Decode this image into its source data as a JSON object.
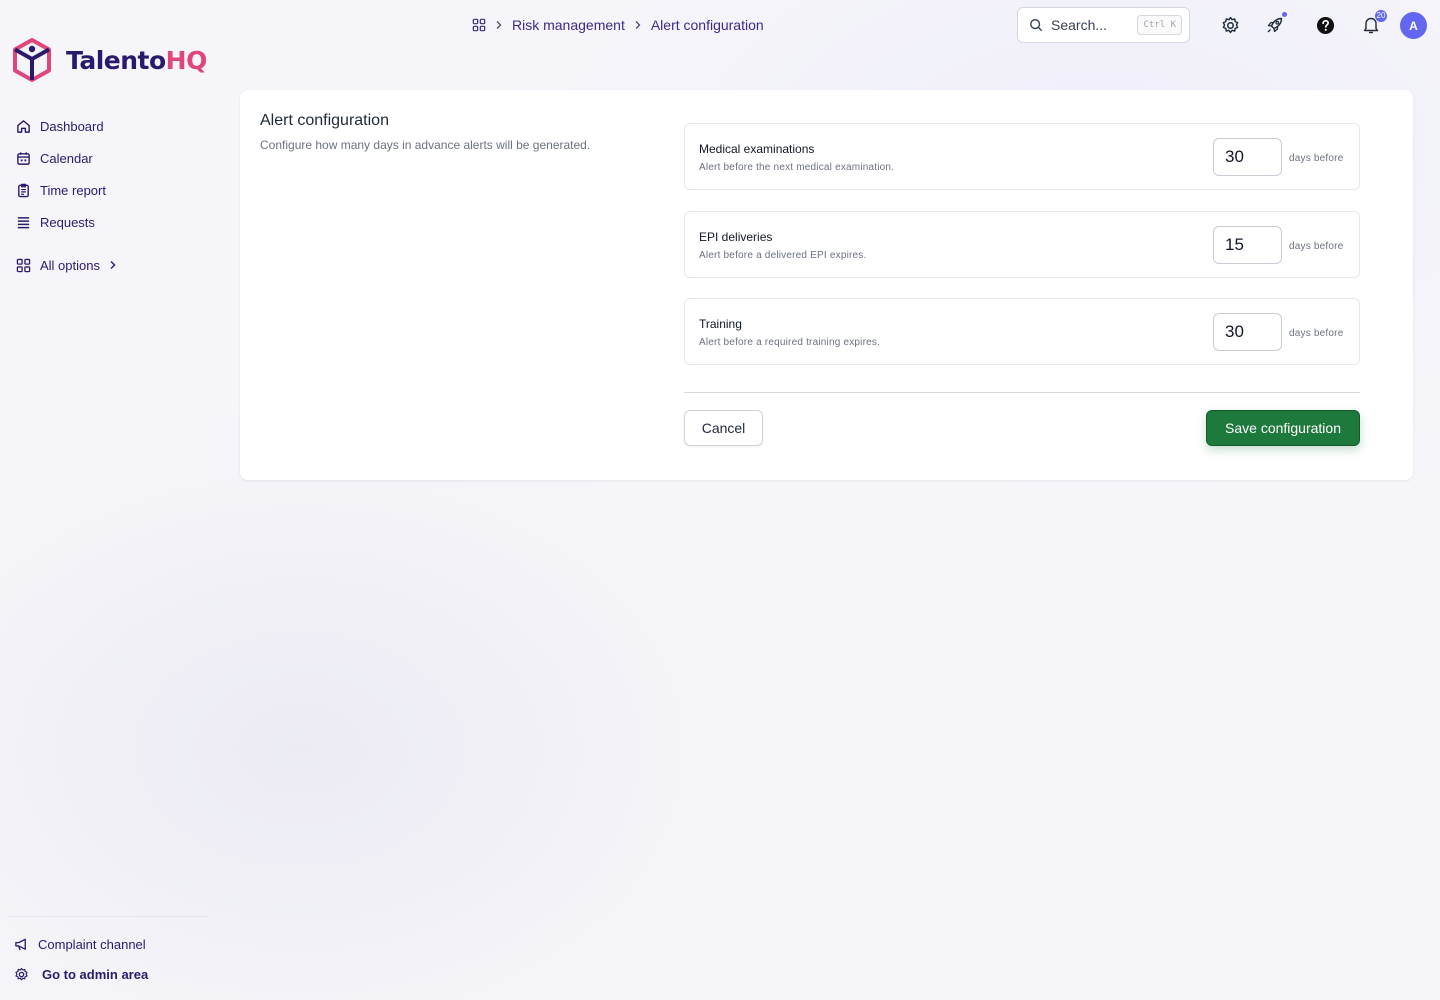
{
  "brand": {
    "name_part1": "Talento",
    "name_part2": "HQ",
    "primary_color": "#2a1a6e",
    "accent_color": "#e0457b"
  },
  "sidebar": {
    "items": [
      {
        "label": "Dashboard",
        "icon": "home-icon"
      },
      {
        "label": "Calendar",
        "icon": "calendar-icon"
      },
      {
        "label": "Time report",
        "icon": "clipboard-icon"
      },
      {
        "label": "Requests",
        "icon": "list-icon"
      }
    ],
    "all_options": {
      "label": "All options",
      "icon": "grid-icon"
    },
    "bottom": [
      {
        "label": "Complaint channel",
        "icon": "megaphone-icon"
      },
      {
        "label": "Go to admin area",
        "icon": "gear-icon"
      }
    ]
  },
  "header": {
    "breadcrumb": [
      "Risk management",
      "Alert configuration"
    ],
    "search": {
      "label": "Search...",
      "shortcut": "Ctrl K"
    },
    "notifications_count": "20",
    "avatar_initial": "A",
    "icons": [
      "gear-icon",
      "rocket-icon",
      "help-icon",
      "bell-icon"
    ]
  },
  "main": {
    "title": "Alert configuration",
    "description": "Configure how many days in advance alerts will be generated.",
    "rows": [
      {
        "name": "Medical examinations",
        "sub": "Alert before the next medical examination.",
        "value": "30",
        "unit": "days before"
      },
      {
        "name": "EPI deliveries",
        "sub": "Alert before a delivered EPI expires.",
        "value": "15",
        "unit": "days before"
      },
      {
        "name": "Training",
        "sub": "Alert before a required training expires.",
        "value": "30",
        "unit": "days before"
      }
    ],
    "cancel_label": "Cancel",
    "save_label": "Save configuration",
    "save_color": "#1e7a3c"
  }
}
